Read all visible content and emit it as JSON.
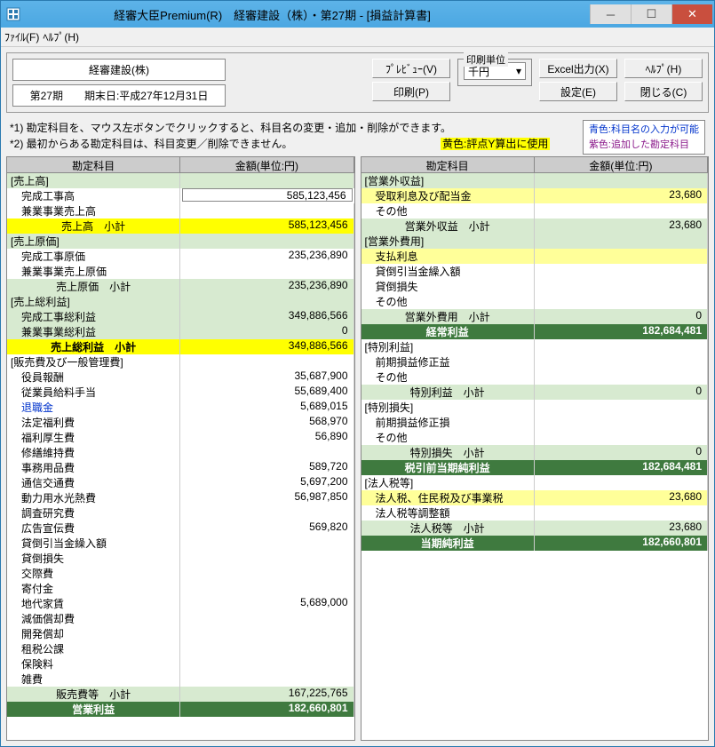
{
  "window": {
    "title": "経審大臣Premium(R)　経審建設（株）・第27期 - [損益計算書]"
  },
  "menubar": {
    "file": "ﾌｧｲﾙ(F)",
    "help": "ﾍﾙﾌﾟ(H)"
  },
  "toolbar": {
    "company": "経審建設(株)",
    "period": "第27期　　期末日:平成27年12月31日",
    "preview": "ﾌﾟﾚﾋﾞｭｰ(V)",
    "print": "印刷(P)",
    "unit_label": "印刷単位",
    "unit_value": "千円",
    "excel": "Excel出力(X)",
    "settings": "設定(E)",
    "help": "ﾍﾙﾌﾟ(H)",
    "close": "閉じる(C)"
  },
  "notes": {
    "n1": "*1) 勘定科目を、マウス左ボタンでクリックすると、科目名の変更・追加・削除ができます。",
    "n2": "*2) 最初からある勘定科目は、科目変更／削除できません。",
    "yellow": "黄色:評点Y算出に使用",
    "legend_blue": "青色:科目名の入力が可能",
    "legend_purple": "紫色:追加した勘定科目"
  },
  "headers": {
    "account": "勘定科目",
    "amount": "金額(単位:円)"
  },
  "left": [
    {
      "name": "[売上高]",
      "amount": "",
      "style": "bg-pale-green"
    },
    {
      "name": "完成工事高",
      "amount": "585,123,456",
      "indent": 1,
      "input": true
    },
    {
      "name": "兼業事業売上高",
      "amount": "",
      "indent": 1
    },
    {
      "name": "売上高　小計",
      "amount": "585,123,456",
      "style": "bg-yellow",
      "center": true
    },
    {
      "name": "[売上原価]",
      "amount": "",
      "style": "bg-pale-green"
    },
    {
      "name": "完成工事原価",
      "amount": "235,236,890",
      "indent": 1
    },
    {
      "name": "兼業事業売上原価",
      "amount": "",
      "indent": 1
    },
    {
      "name": "売上原価　小計",
      "amount": "235,236,890",
      "style": "bg-pale-green",
      "center": true
    },
    {
      "name": "[売上総利益]",
      "amount": "",
      "style": "bg-pale-green"
    },
    {
      "name": "完成工事総利益",
      "amount": "349,886,566",
      "indent": 1,
      "style": "bg-pale-green"
    },
    {
      "name": "兼業事業総利益",
      "amount": "0",
      "indent": 1,
      "style": "bg-pale-green"
    },
    {
      "name": "売上総利益　小計",
      "amount": "349,886,566",
      "style": "bg-yellow",
      "center": true,
      "bold": true
    },
    {
      "name": "[販売費及び一般管理費]",
      "amount": ""
    },
    {
      "name": "役員報酬",
      "amount": "35,687,900",
      "indent": 1
    },
    {
      "name": "従業員給料手当",
      "amount": "55,689,400",
      "indent": 1
    },
    {
      "name": "退職金",
      "amount": "5,689,015",
      "indent": 1,
      "txtblue": true
    },
    {
      "name": "法定福利費",
      "amount": "568,970",
      "indent": 1
    },
    {
      "name": "福利厚生費",
      "amount": "56,890",
      "indent": 1
    },
    {
      "name": "修繕維持費",
      "amount": "",
      "indent": 1
    },
    {
      "name": "事務用品費",
      "amount": "589,720",
      "indent": 1
    },
    {
      "name": "通信交通費",
      "amount": "5,697,200",
      "indent": 1
    },
    {
      "name": "動力用水光熱費",
      "amount": "56,987,850",
      "indent": 1
    },
    {
      "name": "調査研究費",
      "amount": "",
      "indent": 1
    },
    {
      "name": "広告宣伝費",
      "amount": "569,820",
      "indent": 1
    },
    {
      "name": "貸倒引当金繰入額",
      "amount": "",
      "indent": 1
    },
    {
      "name": "貸倒損失",
      "amount": "",
      "indent": 1
    },
    {
      "name": "交際費",
      "amount": "",
      "indent": 1
    },
    {
      "name": "寄付金",
      "amount": "",
      "indent": 1
    },
    {
      "name": "地代家賃",
      "amount": "5,689,000",
      "indent": 1
    },
    {
      "name": "減価償却費",
      "amount": "",
      "indent": 1
    },
    {
      "name": "開発償却",
      "amount": "",
      "indent": 1
    },
    {
      "name": "租税公課",
      "amount": "",
      "indent": 1
    },
    {
      "name": "保険料",
      "amount": "",
      "indent": 1
    },
    {
      "name": "雑費",
      "amount": "",
      "indent": 1
    },
    {
      "name": "販売費等　小計",
      "amount": "167,225,765",
      "style": "bg-pale-green",
      "center": true
    },
    {
      "name": "営業利益",
      "amount": "182,660,801",
      "style": "bg-dark-green",
      "center": true
    }
  ],
  "right": [
    {
      "name": "[営業外収益]",
      "amount": "",
      "style": "bg-pale-green"
    },
    {
      "name": "受取利息及び配当金",
      "amount": "23,680",
      "indent": 1,
      "style": "bg-yellow-alt"
    },
    {
      "name": "その他",
      "amount": "",
      "indent": 1
    },
    {
      "name": "営業外収益　小計",
      "amount": "23,680",
      "style": "bg-pale-green",
      "center": true
    },
    {
      "name": "[営業外費用]",
      "amount": "",
      "style": "bg-pale-green"
    },
    {
      "name": "支払利息",
      "amount": "",
      "indent": 1,
      "style": "bg-yellow-alt"
    },
    {
      "name": "貸倒引当金繰入額",
      "amount": "",
      "indent": 1
    },
    {
      "name": "貸倒損失",
      "amount": "",
      "indent": 1
    },
    {
      "name": "その他",
      "amount": "",
      "indent": 1
    },
    {
      "name": "営業外費用　小計",
      "amount": "0",
      "style": "bg-pale-green",
      "center": true
    },
    {
      "name": "経常利益",
      "amount": "182,684,481",
      "style": "bg-dark-green",
      "center": true
    },
    {
      "name": "[特別利益]",
      "amount": ""
    },
    {
      "name": "前期損益修正益",
      "amount": "",
      "indent": 1
    },
    {
      "name": "その他",
      "amount": "",
      "indent": 1
    },
    {
      "name": "特別利益　小計",
      "amount": "0",
      "style": "bg-pale-green",
      "center": true
    },
    {
      "name": "[特別損失]",
      "amount": ""
    },
    {
      "name": "前期損益修正損",
      "amount": "",
      "indent": 1
    },
    {
      "name": "その他",
      "amount": "",
      "indent": 1
    },
    {
      "name": "特別損失　小計",
      "amount": "0",
      "style": "bg-pale-green",
      "center": true
    },
    {
      "name": "税引前当期純利益",
      "amount": "182,684,481",
      "style": "bg-dark-green",
      "center": true
    },
    {
      "name": "[法人税等]",
      "amount": ""
    },
    {
      "name": "法人税、住民税及び事業税",
      "amount": "23,680",
      "indent": 1,
      "style": "bg-yellow-alt"
    },
    {
      "name": "法人税等調整額",
      "amount": "",
      "indent": 1
    },
    {
      "name": "法人税等　小計",
      "amount": "23,680",
      "style": "bg-pale-green",
      "center": true
    },
    {
      "name": "当期純利益",
      "amount": "182,660,801",
      "style": "bg-dark-green",
      "center": true
    }
  ]
}
